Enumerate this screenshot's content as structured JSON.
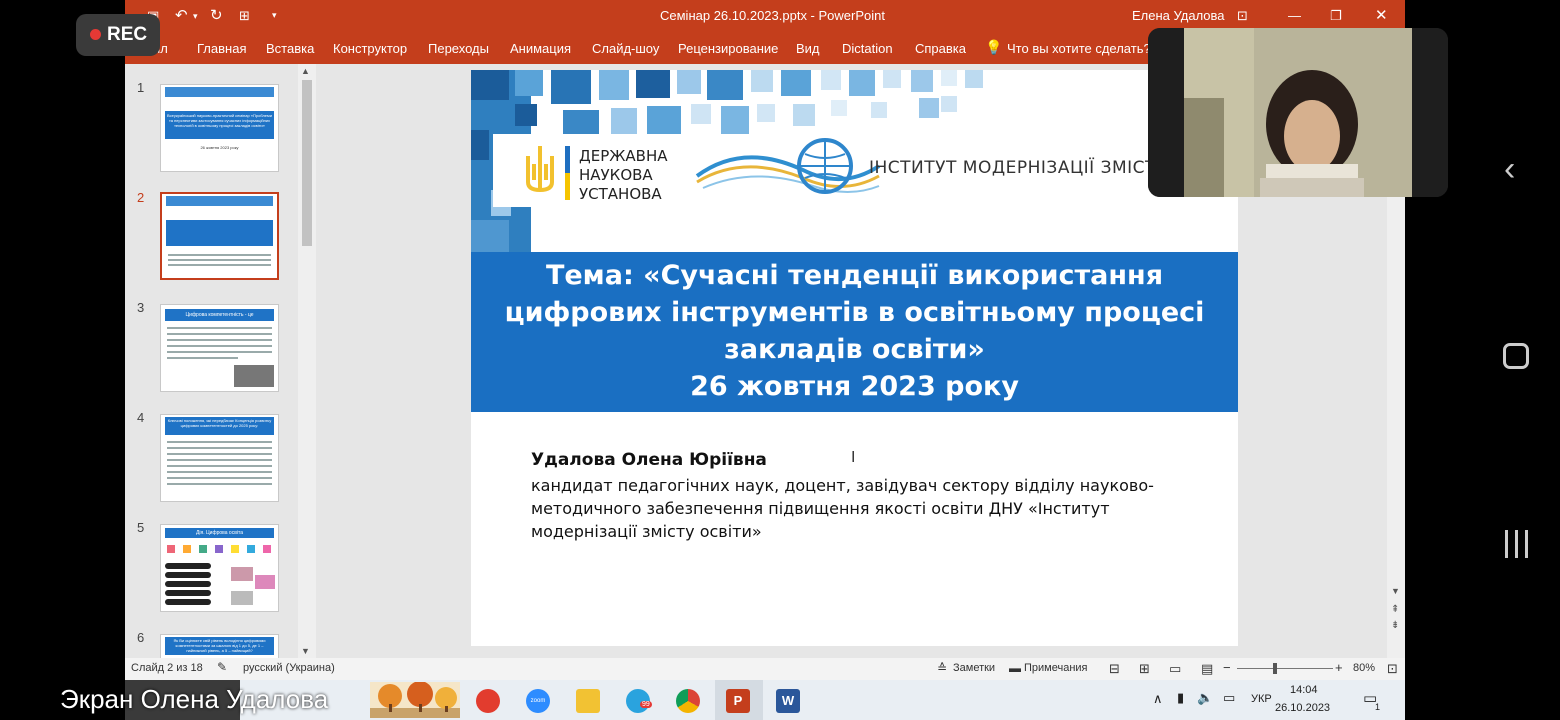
{
  "recording": {
    "label": "REC"
  },
  "window": {
    "title": "Семінар 26.10.2023.pptx  -  PowerPoint",
    "user": "Елена Удалова"
  },
  "menu": {
    "items": [
      "йл",
      "Главная",
      "Вставка",
      "Конструктор",
      "Переходы",
      "Анимация",
      "Слайд-шоу",
      "Рецензирование",
      "Вид",
      "Dictation",
      "Справка"
    ],
    "tellme": "Что вы хотите сделать?"
  },
  "thumbnails": {
    "numbers": [
      "1",
      "2",
      "3",
      "4",
      "5",
      "6"
    ],
    "t1_title": "Всеукраїнський науково-практичний семінар «Проблеми та перспективи застосування сучасних інформаційних технологій в освітньому процесі закладів освіти»",
    "t1_date": "26 жовтня 2023 року",
    "t3_title": "Цифрова компетентність - це",
    "t4_title": "Ключові положення, які передбачає Концепція розвитку цифрових компетентностей до 2025 року:",
    "t5_title": "Дія. Цифрова освіта",
    "t6_title": "Як Ви оцінюєте свій рівень володіння цифровими компетентностями за шкалою від 1 до 5, де 1 – найнижчий рівень, а 5 – найвищий?"
  },
  "slide": {
    "org_line1": "ДЕРЖАВНА",
    "org_line2": "НАУКОВА",
    "org_line3": "УСТАНОВА",
    "institute": "ІНСТИТУТ МОДЕРНІЗАЦІЇ ЗМІСТУ",
    "title_l1": "Тема: «Сучасні тенденції використання",
    "title_l2": "цифрових інструментів в освітньому процесі",
    "title_l3": "закладів освіти»",
    "title_l4": "26 жовтня 2023 року",
    "author": "Удалова Олена Юріївна",
    "bio_l1": "кандидат педагогічних наук, доцент, завідувач сектору відділу науково-",
    "bio_l2": "методичного забезпечення підвищення якості освіти ДНУ «Інститут",
    "bio_l3": "модернізації змісту освіти»"
  },
  "status": {
    "slide": "Слайд 2 из 18",
    "lang": "русский (Украина)",
    "notes": "Заметки",
    "comments": "Примечания",
    "zoom": "80%"
  },
  "taskbar": {
    "caption": "Экран Олена Удалова",
    "lang": "УКР",
    "time": "14:04",
    "date": "26.10.2023",
    "notif": "1",
    "tg_badge": "99"
  },
  "colors": {
    "ppt_red": "#c43e1c",
    "slide_blue": "#1a6fc2"
  }
}
